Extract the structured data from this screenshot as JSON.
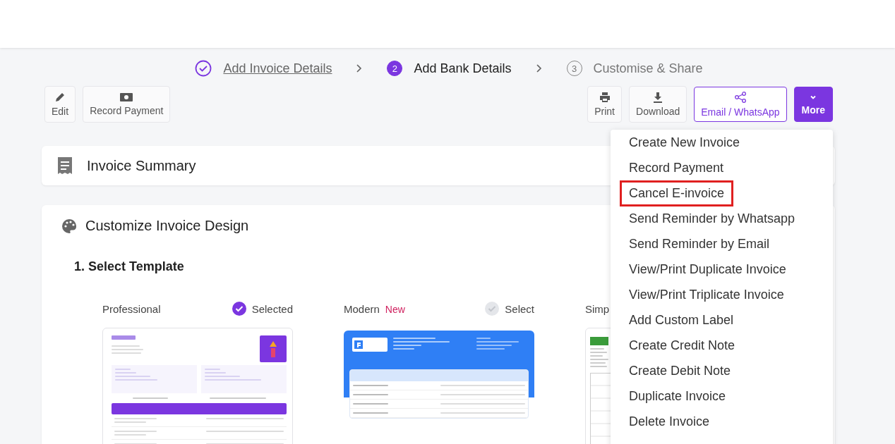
{
  "stepper": [
    {
      "label": "Add Invoice Details",
      "completed": true,
      "selected": false
    },
    {
      "number": "2",
      "label": "Add Bank Details",
      "completed": false,
      "selected": true
    },
    {
      "number": "3",
      "label": "Customise & Share",
      "completed": false,
      "selected": false
    }
  ],
  "toolbar_left": [
    {
      "label": "Edit"
    },
    {
      "label": "Record Payment"
    }
  ],
  "toolbar_right": [
    {
      "label": "Print",
      "kind": "plain"
    },
    {
      "label": "Download",
      "kind": "plain"
    },
    {
      "label": "Email / WhatsApp",
      "kind": "outline"
    },
    {
      "label": "More",
      "kind": "primary"
    }
  ],
  "invoice_summary": {
    "title": "Invoice Summary"
  },
  "customize": {
    "title": "Customize Invoice Design",
    "section": "1. Select Template",
    "templates": [
      {
        "name": "Professional",
        "selected": true,
        "select_label": "Selected",
        "kind": "professional"
      },
      {
        "name": "Modern",
        "badge": "New",
        "selected": false,
        "select_label": "Select",
        "kind": "modern"
      },
      {
        "name": "Simp",
        "kind": "simple"
      }
    ]
  },
  "more_menu": {
    "items": [
      {
        "label": "Create New Invoice",
        "highlighted": false
      },
      {
        "label": "Record Payment",
        "highlighted": false
      },
      {
        "label": "Cancel E-invoice",
        "highlighted": true
      },
      {
        "label": "Send Reminder by Whatsapp",
        "highlighted": false
      },
      {
        "label": "Send Reminder by Email",
        "highlighted": false
      },
      {
        "label": "View/Print Duplicate Invoice",
        "highlighted": false
      },
      {
        "label": "View/Print Triplicate Invoice",
        "highlighted": false
      },
      {
        "label": "Add Custom Label",
        "highlighted": false
      },
      {
        "label": "Create Credit Note",
        "highlighted": false
      },
      {
        "label": "Create Debit Note",
        "highlighted": false
      },
      {
        "label": "Duplicate Invoice",
        "highlighted": false
      },
      {
        "label": "Delete Invoice",
        "highlighted": false
      }
    ]
  }
}
